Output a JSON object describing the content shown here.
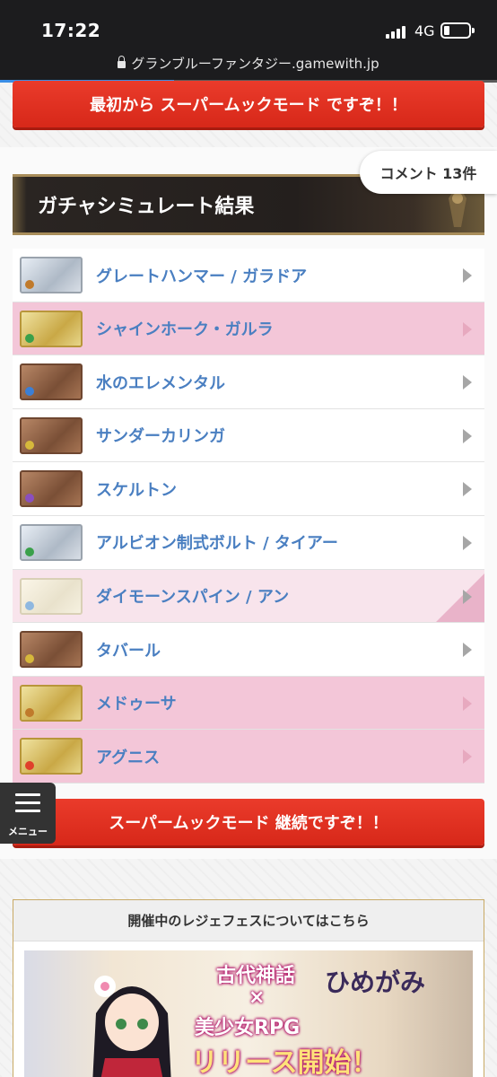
{
  "status_bar": {
    "time": "17:22",
    "network": "4G"
  },
  "browser": {
    "url": "グランブルーファンタジー.gamewith.jp",
    "load_progress": 0.35
  },
  "top_button": {
    "label": "最初から スーパームックモード ですぞ！！"
  },
  "comments": {
    "label": "コメント 13件"
  },
  "result_header": {
    "title": "ガチャシミュレート結果"
  },
  "results": [
    {
      "name": "グレートハンマー / ガラドア",
      "highlight": "none",
      "frame": "silver",
      "element_color": "#c07a2b"
    },
    {
      "name": "シャインホーク・ガルラ",
      "highlight": "pink",
      "frame": "gold",
      "element_color": "#3aa04a"
    },
    {
      "name": "水のエレメンタル",
      "highlight": "none",
      "frame": "bronze",
      "element_color": "#3b7fd6"
    },
    {
      "name": "サンダーカリンガ",
      "highlight": "none",
      "frame": "bronze",
      "element_color": "#d6b83b"
    },
    {
      "name": "スケルトン",
      "highlight": "none",
      "frame": "bronze",
      "element_color": "#8a4fbf"
    },
    {
      "name": "アルビオン制式ボルト / タイアー",
      "highlight": "none",
      "frame": "silver",
      "element_color": "#3aa04a"
    },
    {
      "name": "ダイモーンスパイン / アン",
      "highlight": "lightpink",
      "frame": "pale",
      "element_color": "#8fb8e0"
    },
    {
      "name": "タバール",
      "highlight": "none",
      "frame": "bronze",
      "element_color": "#d6b83b"
    },
    {
      "name": "メドゥーサ",
      "highlight": "pink",
      "frame": "gold",
      "element_color": "#c07a2b"
    },
    {
      "name": "アグニス",
      "highlight": "pink",
      "frame": "gold",
      "element_color": "#e0402b"
    }
  ],
  "menu": {
    "label": "メニュー"
  },
  "continue_button": {
    "label": "スーパームックモード 継続ですぞ！！"
  },
  "legfes": {
    "title": "開催中のレジェフェスについてはこちら",
    "banner_lines": [
      "古代神話",
      "×",
      "美少女RPG",
      "リリース開始！"
    ],
    "banner_logo": "ひめがみ"
  }
}
